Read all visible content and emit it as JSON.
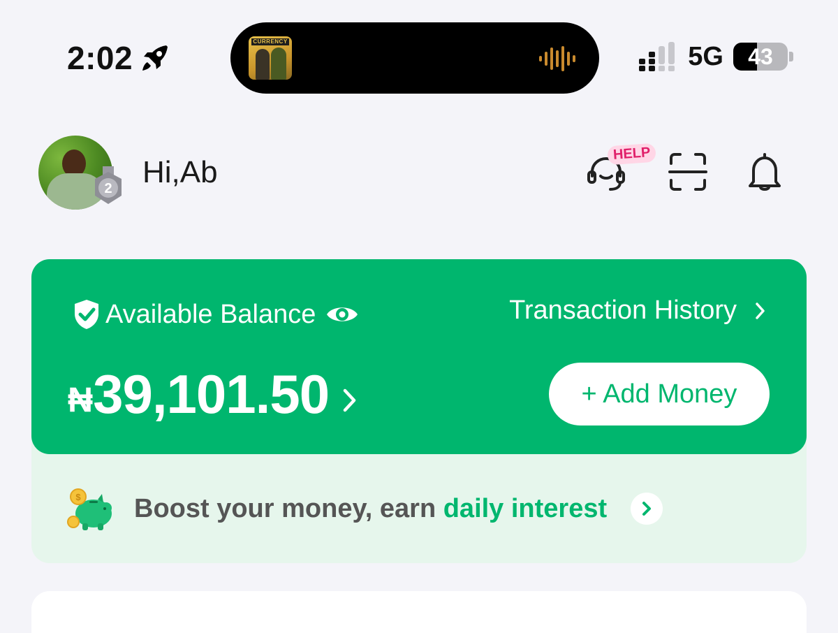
{
  "status_bar": {
    "time": "2:02",
    "network": "5G",
    "battery": "43",
    "battery_level": 0.43,
    "now_playing_title": "CURRENCY"
  },
  "header": {
    "greeting": "Hi,Ab",
    "avatar_badge": "2",
    "help_badge": "HELP"
  },
  "balance_card": {
    "label": "Available Balance",
    "transaction_history": "Transaction History",
    "currency_symbol": "₦",
    "amount": "39,101.50",
    "add_money": "+ Add Money"
  },
  "promo": {
    "text": "Boost your money, earn ",
    "link": "daily interest"
  },
  "icons": {
    "rocket": "rocket-icon",
    "signal": "signal-icon",
    "support": "headset-icon",
    "scan": "scan-icon",
    "notifications": "bell-icon",
    "shield": "shield-check-icon",
    "visibility": "eye-icon",
    "piggy": "piggy-bank-icon"
  },
  "colors": {
    "brand_green": "#00b66e",
    "promo_bg": "#e6f6ec",
    "page_bg": "#f4f4f9",
    "help_pink": "#e0206a"
  }
}
